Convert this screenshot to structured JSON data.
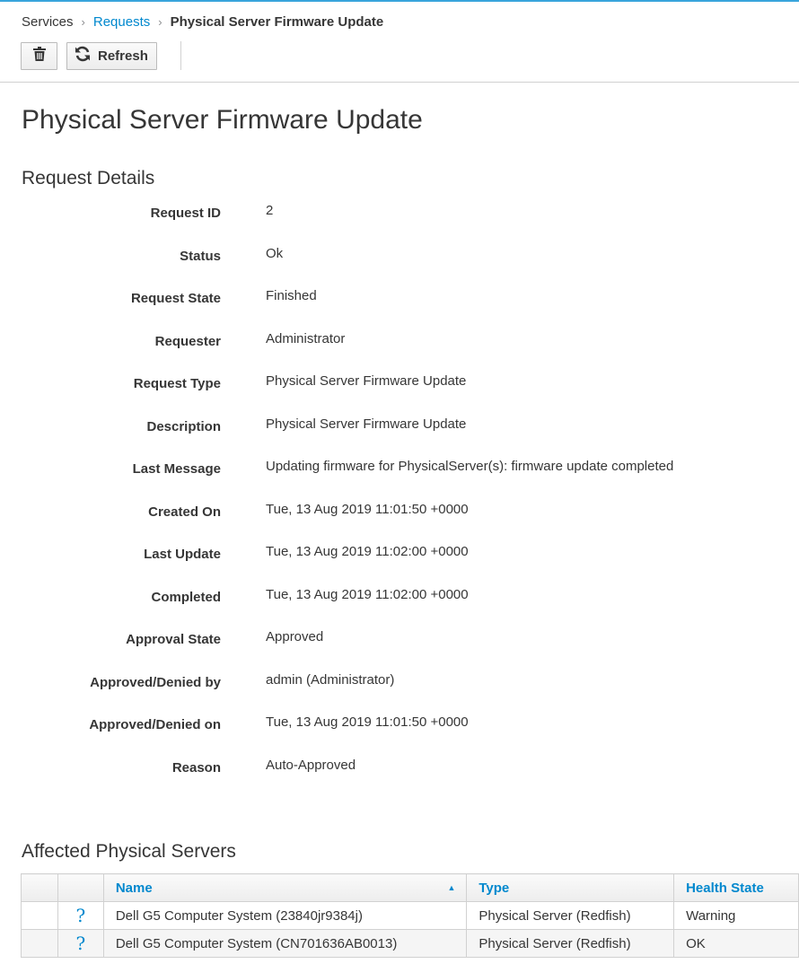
{
  "breadcrumb": {
    "items": [
      "Services",
      "Requests",
      "Physical Server Firmware Update"
    ]
  },
  "toolbar": {
    "delete_icon": "trash-icon",
    "refresh_icon": "refresh-icon",
    "refresh_label": "Refresh"
  },
  "page": {
    "title": "Physical Server Firmware Update"
  },
  "request_details": {
    "title": "Request Details",
    "rows": [
      {
        "label": "Request ID",
        "value": "2"
      },
      {
        "label": "Status",
        "value": "Ok"
      },
      {
        "label": "Request State",
        "value": "Finished"
      },
      {
        "label": "Requester",
        "value": "Administrator"
      },
      {
        "label": "Request Type",
        "value": "Physical Server Firmware Update"
      },
      {
        "label": "Description",
        "value": "Physical Server Firmware Update"
      },
      {
        "label": "Last Message",
        "value": "Updating firmware for PhysicalServer(s): firmware update completed"
      },
      {
        "label": "Created On",
        "value": "Tue, 13 Aug 2019 11:01:50 +0000"
      },
      {
        "label": "Last Update",
        "value": "Tue, 13 Aug 2019 11:02:00 +0000"
      },
      {
        "label": "Completed",
        "value": "Tue, 13 Aug 2019 11:02:00 +0000"
      },
      {
        "label": "Approval State",
        "value": "Approved"
      },
      {
        "label": "Approved/Denied by",
        "value": "admin (Administrator)"
      },
      {
        "label": "Approved/Denied on",
        "value": "Tue, 13 Aug 2019 11:01:50 +0000"
      },
      {
        "label": "Reason",
        "value": "Auto-Approved"
      }
    ]
  },
  "affected": {
    "title": "Affected Physical Servers",
    "columns": [
      "Name",
      "Type",
      "Health State"
    ],
    "rows": [
      {
        "icon": "?",
        "name": "Dell G5 Computer System (23840jr9384j)",
        "type": "Physical Server (Redfish)",
        "health": "Warning"
      },
      {
        "icon": "?",
        "name": "Dell G5 Computer System (CN701636AB0013)",
        "type": "Physical Server (Redfish)",
        "health": "OK"
      }
    ]
  },
  "colors": {
    "accent": "#39a5dc",
    "link": "#0088ce",
    "text": "#363636"
  }
}
